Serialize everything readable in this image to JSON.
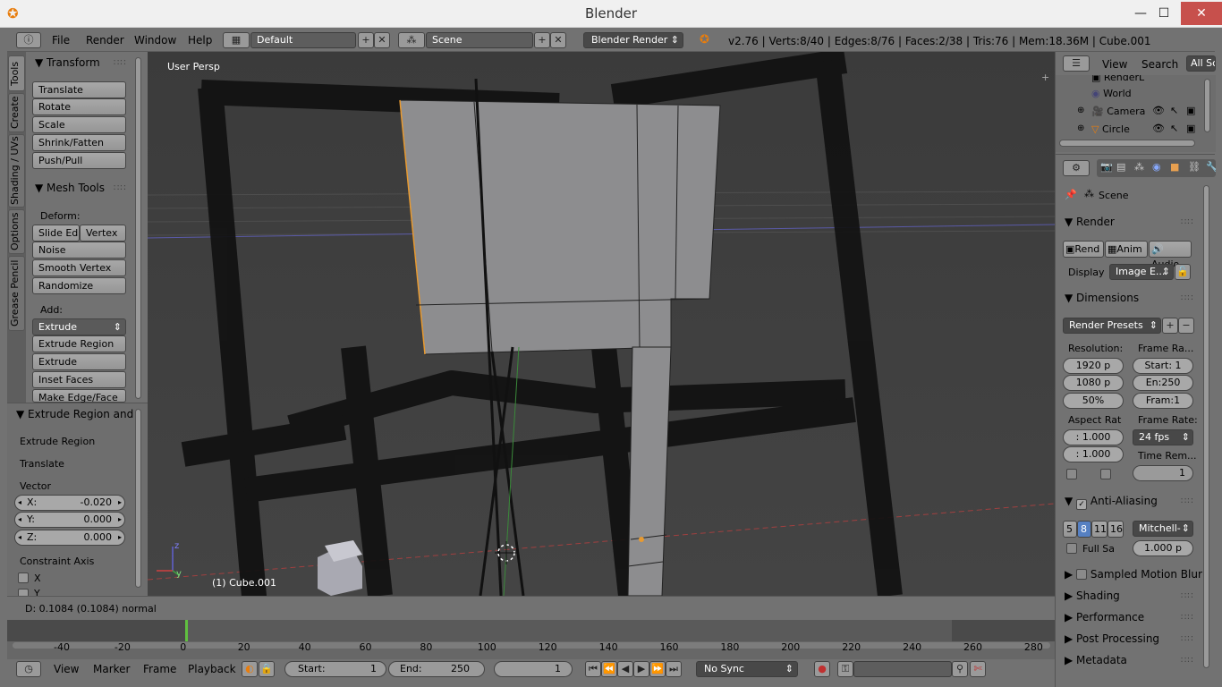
{
  "window": {
    "title": "Blender"
  },
  "header": {
    "menus": [
      "File",
      "Render",
      "Window",
      "Help"
    ],
    "layout_value": "Default",
    "scene_value": "Scene",
    "engine_value": "Blender Render",
    "stats": "v2.76 | Verts:8/40 | Edges:8/76 | Faces:2/38 | Tris:76 | Mem:18.36M | Cube.001"
  },
  "tool_tabs": [
    "Tools",
    "Create",
    "Shading / UVs",
    "Options",
    "Grease Pencil"
  ],
  "toolshelf": {
    "transform_title": "Transform",
    "transform_buttons": [
      "Translate",
      "Rotate",
      "Scale",
      "Shrink/Fatten",
      "Push/Pull"
    ],
    "mesh_tools_title": "Mesh Tools",
    "deform_label": "Deform:",
    "slide_edge": "Slide Ed",
    "vertex": "Vertex",
    "deform_buttons": [
      "Noise",
      "Smooth Vertex",
      "Randomize"
    ],
    "add_label": "Add:",
    "extrude": "Extrude",
    "add_buttons": [
      "Extrude Region",
      "Extrude Individual",
      "Inset Faces",
      "Make Edge/Face"
    ]
  },
  "operator": {
    "title": "Extrude Region and",
    "line1": "Extrude Region",
    "line2": "Translate",
    "vector_label": "Vector",
    "x_label": "X:",
    "x_value": "-0.020",
    "y_label": "Y:",
    "y_value": "0.000",
    "z_label": "Z:",
    "z_value": "0.000",
    "constraint_label": "Constraint Axis",
    "cx": "X",
    "cy": "Y"
  },
  "viewport": {
    "view_label": "User Persp",
    "object_label": "(1) Cube.001"
  },
  "statusbar": {
    "text": "D: 0.1084 (0.1084) normal"
  },
  "timeline": {
    "ticks": [
      "-40",
      "-20",
      "0",
      "20",
      "40",
      "60",
      "80",
      "100",
      "120",
      "140",
      "160",
      "180",
      "200",
      "220",
      "240",
      "260",
      "280"
    ],
    "menus": [
      "View",
      "Marker",
      "Frame",
      "Playback"
    ],
    "start_label": "Start:",
    "start_value": "1",
    "end_label": "End:",
    "end_value": "250",
    "current_frame": "1",
    "sync_value": "No Sync"
  },
  "outliner": {
    "menus": [
      "View",
      "Search",
      "All Sc"
    ],
    "items": [
      "RenderL",
      "World",
      "Camera",
      "Circle"
    ]
  },
  "properties": {
    "scene_label": "Scene",
    "render_title": "Render",
    "render_btn": "Rend",
    "anim_btn": "Anim",
    "audio_btn": "Audio",
    "display_label": "Display",
    "display_value": "Image E...",
    "dimensions_title": "Dimensions",
    "presets": "Render Presets",
    "resolution_label": "Resolution:",
    "framerange_label": "Frame Ra...",
    "res_x": "1920 p",
    "res_y": "1080 p",
    "res_pct": "50%",
    "start": "Start: 1",
    "end": "En:250",
    "frame": "Fram:1",
    "aspect_label": "Aspect Rat",
    "framerate_label": "Frame Rate:",
    "aspect_x": ": 1.000",
    "aspect_y": ": 1.000",
    "fps": "24 fps",
    "time_remap": "Time Rem...",
    "remap_value": "1",
    "aa_title": "Anti-Aliasing",
    "aa_samples": [
      "5",
      "8",
      "11",
      "16"
    ],
    "aa_filter": "Mitchell-",
    "full_sample": "Full Sa",
    "filter_size": "1.000 p",
    "motion_blur": "Sampled Motion Blur",
    "shading": "Shading",
    "performance": "Performance",
    "post_processing": "Post Processing",
    "metadata": "Metadata"
  }
}
